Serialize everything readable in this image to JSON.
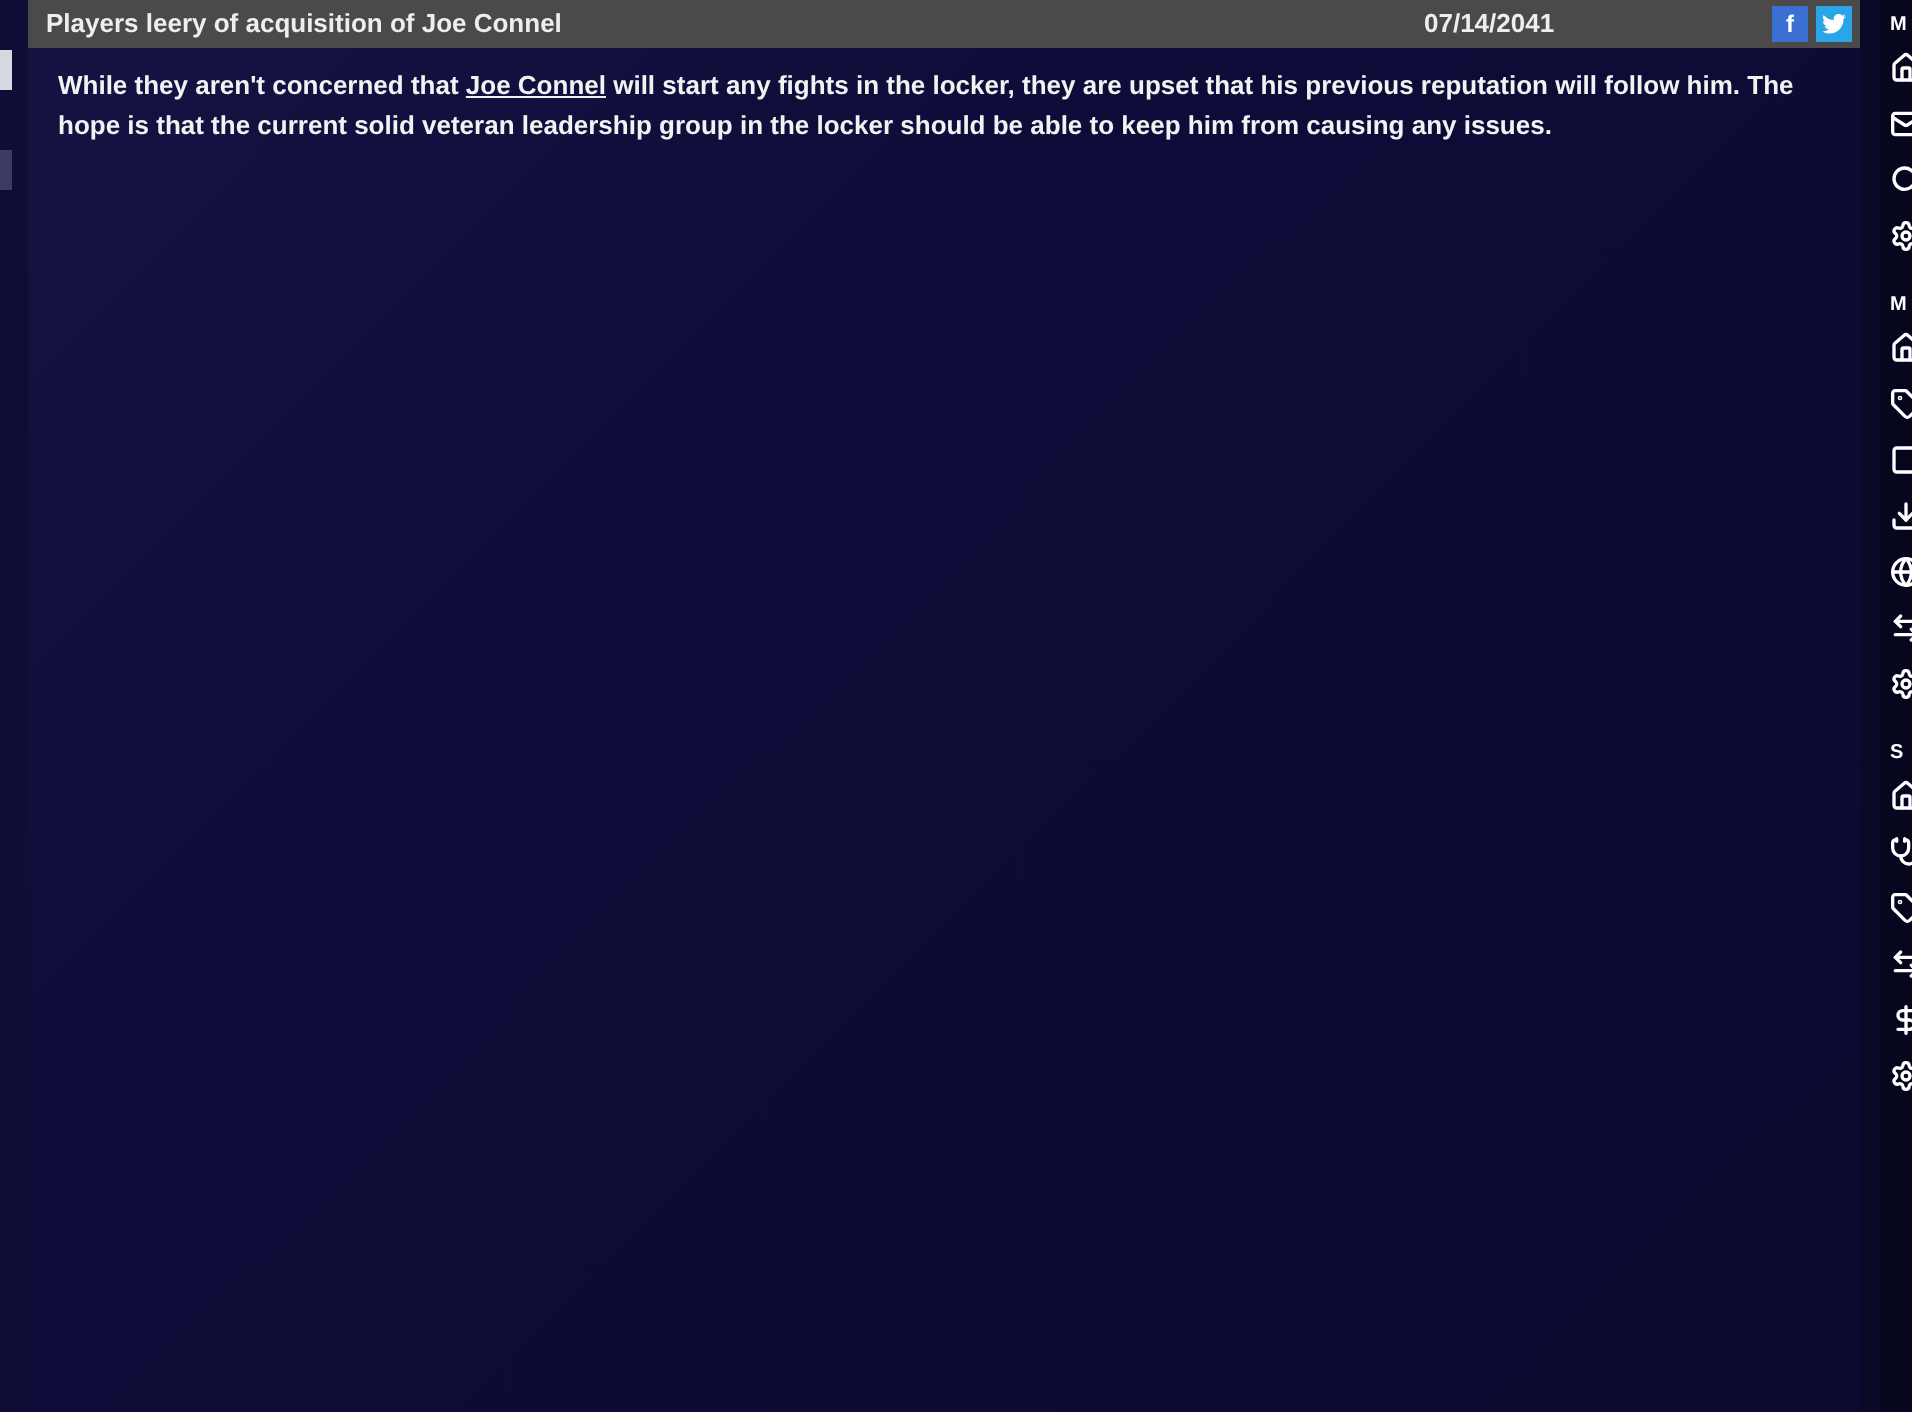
{
  "article": {
    "title": "Players leery of acquisition of Joe Connel",
    "date": "07/14/2041",
    "share": [
      {
        "kind": "facebook",
        "label": "f"
      },
      {
        "kind": "twitter"
      }
    ],
    "body": [
      {
        "kind": "text",
        "text": "While they aren't concerned that "
      },
      {
        "kind": "link",
        "text": "Joe Connel"
      },
      {
        "kind": "text",
        "text": " will start any fights in the locker, they are upset that his previous reputation will follow him.  The hope is that the current solid veteran leadership group in the locker should be able to keep him from causing any issues."
      }
    ]
  },
  "sidebar": {
    "sections": [
      {
        "heading": "M",
        "items": [
          {
            "kind": "home"
          },
          {
            "kind": "mail"
          },
          {
            "kind": "search"
          },
          {
            "kind": "gear"
          }
        ]
      },
      {
        "heading": "M",
        "items": [
          {
            "kind": "home"
          },
          {
            "kind": "tag"
          },
          {
            "kind": "square"
          },
          {
            "kind": "download"
          },
          {
            "kind": "globe"
          },
          {
            "kind": "arrows"
          },
          {
            "kind": "gear"
          }
        ]
      },
      {
        "heading": "S",
        "items": [
          {
            "kind": "home"
          },
          {
            "kind": "stethoscope"
          },
          {
            "kind": "tag"
          },
          {
            "kind": "arrows"
          },
          {
            "kind": "dollar"
          },
          {
            "kind": "gear"
          }
        ]
      }
    ]
  }
}
